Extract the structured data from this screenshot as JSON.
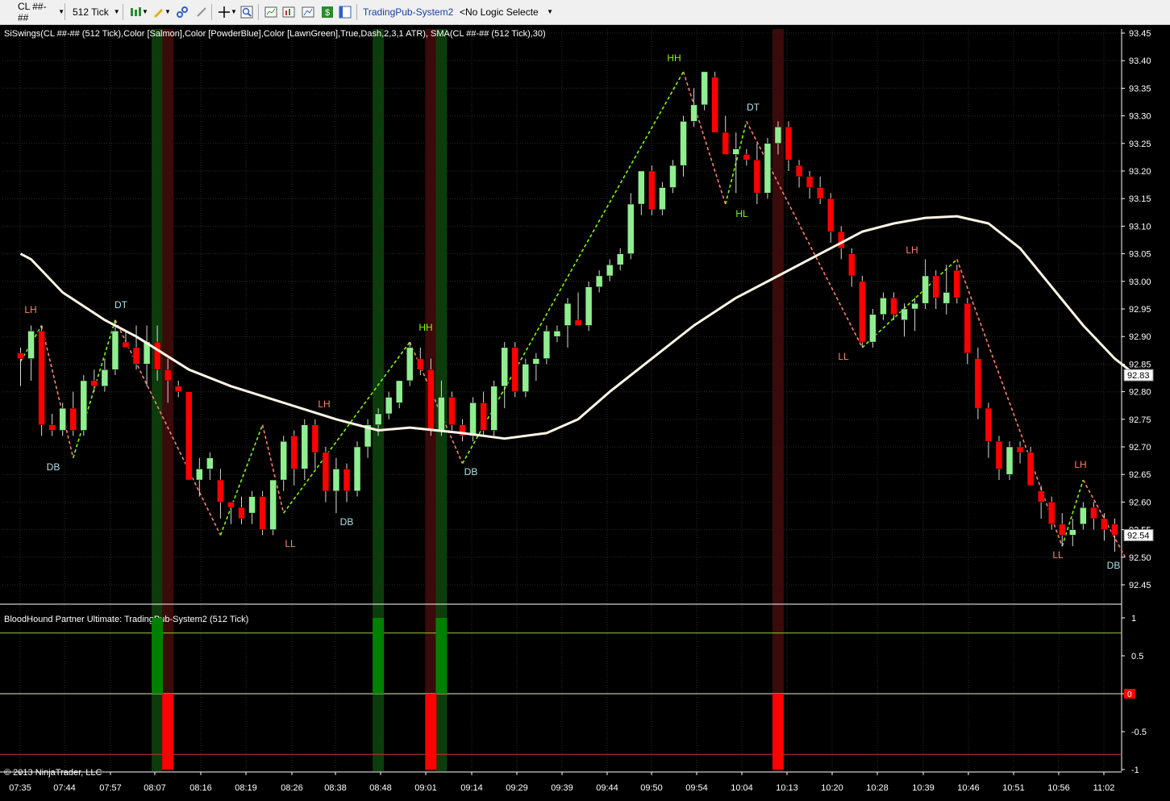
{
  "toolbar": {
    "instrument": "CL ##-##",
    "interval": "512 Tick",
    "strategy_label": "TradingPub-System2",
    "logic_select": "<No Logic Selecte",
    "icons": [
      "bar-style-icon",
      "draw-pencil-icon",
      "link-icon",
      "unlink-icon",
      "crosshair-icon",
      "zoom-icon",
      "data-box-icon",
      "chart-props-icon",
      "dollar-icon",
      "window-icon"
    ]
  },
  "price_panel": {
    "title": "SiSwings(CL ##-## (512 Tick),Color [Salmon],Color [PowderBlue],Color [LawnGreen],True,Dash,2,3,1 ATR), SMA(CL ##-## (512 Tick),30)",
    "y_ticks": [
      "93.45",
      "93.40",
      "93.35",
      "93.30",
      "93.25",
      "93.20",
      "93.15",
      "93.10",
      "93.05",
      "93.00",
      "92.95",
      "92.90",
      "92.85",
      "92.80",
      "92.75",
      "92.70",
      "92.65",
      "92.60",
      "92.55",
      "92.50",
      "92.45"
    ],
    "current_price": "92.83",
    "last_price": "92.54"
  },
  "swing_labels": [
    {
      "t": "LH",
      "c": "#fa8072"
    },
    {
      "t": "DT",
      "c": "#b0e0e6"
    },
    {
      "t": "DB",
      "c": "#b0e0e6"
    },
    {
      "t": "LH",
      "c": "#fa8072"
    },
    {
      "t": "LL",
      "c": "#fa8072"
    },
    {
      "t": "DB",
      "c": "#b0e0e6"
    },
    {
      "t": "HH",
      "c": "#7cfc00"
    },
    {
      "t": "DB",
      "c": "#b0e0e6"
    },
    {
      "t": "HH",
      "c": "#7cfc00"
    },
    {
      "t": "DT",
      "c": "#b0e0e6"
    },
    {
      "t": "HL",
      "c": "#7cfc00"
    },
    {
      "t": "LH",
      "c": "#fa8072"
    },
    {
      "t": "LL",
      "c": "#fa8072"
    },
    {
      "t": "LH",
      "c": "#fa8072"
    },
    {
      "t": "LL",
      "c": "#fa8072"
    },
    {
      "t": "DB",
      "c": "#b0e0e6"
    }
  ],
  "indicator_panel": {
    "title": "BloodHound Partner Ultimate: TradingPub-System2 (512 Tick)",
    "y_ticks": [
      "1",
      "0.5",
      "0",
      "-0.5",
      "-1"
    ],
    "copyright": "© 2013 NinjaTrader, LLC"
  },
  "x_ticks": [
    "07:35",
    "07:44",
    "07:57",
    "08:07",
    "08:16",
    "08:19",
    "08:26",
    "08:38",
    "08:48",
    "09:01",
    "09:14",
    "09:29",
    "09:39",
    "09:44",
    "09:50",
    "09:54",
    "10:04",
    "10:13",
    "10:20",
    "10:28",
    "10:39",
    "10:46",
    "10:51",
    "10:56",
    "11:02"
  ],
  "colors": {
    "up": "#90ee90",
    "down": "#ff0000",
    "sma": "#fff5e6",
    "signal_up": "#008000",
    "signal_down": "#ff0000"
  },
  "chart_data": {
    "type": "candlestick",
    "title": "SiSwings(CL ##-## (512 Tick),Color [Salmon],Color [PowderBlue],Color [LawnGreen],True,Dash,2,3,1 ATR), SMA(CL ##-## (512 Tick),30)",
    "ylim": [
      92.42,
      93.47
    ],
    "candles": [
      [
        92.87,
        92.88,
        92.81,
        92.86
      ],
      [
        92.86,
        92.92,
        92.82,
        92.91
      ],
      [
        92.91,
        92.92,
        92.72,
        92.74
      ],
      [
        92.74,
        92.76,
        92.72,
        92.73
      ],
      [
        92.73,
        92.78,
        92.72,
        92.77
      ],
      [
        92.77,
        92.8,
        92.72,
        92.73
      ],
      [
        92.73,
        92.83,
        92.72,
        92.82
      ],
      [
        92.82,
        92.84,
        92.8,
        92.81
      ],
      [
        92.81,
        92.86,
        92.8,
        92.84
      ],
      [
        92.84,
        92.93,
        92.83,
        92.91
      ],
      [
        92.89,
        92.91,
        92.88,
        92.88
      ],
      [
        92.88,
        92.92,
        92.84,
        92.85
      ],
      [
        92.85,
        92.92,
        92.81,
        92.89
      ],
      [
        92.89,
        92.92,
        92.82,
        92.84
      ],
      [
        92.84,
        92.86,
        92.78,
        92.82
      ],
      [
        92.81,
        92.82,
        92.79,
        92.8
      ],
      [
        92.8,
        92.8,
        92.66,
        92.64
      ],
      [
        92.64,
        92.68,
        92.61,
        92.66
      ],
      [
        92.66,
        92.69,
        92.64,
        92.68
      ],
      [
        92.64,
        92.66,
        92.57,
        92.6
      ],
      [
        92.6,
        92.6,
        92.56,
        92.59
      ],
      [
        92.59,
        92.61,
        92.56,
        92.57
      ],
      [
        92.58,
        92.62,
        92.56,
        92.61
      ],
      [
        92.61,
        92.62,
        92.54,
        92.55
      ],
      [
        92.55,
        92.64,
        92.54,
        92.64
      ],
      [
        92.64,
        92.72,
        92.62,
        92.71
      ],
      [
        92.72,
        92.73,
        92.63,
        92.66
      ],
      [
        92.66,
        92.75,
        92.64,
        92.74
      ],
      [
        92.74,
        92.75,
        92.66,
        92.69
      ],
      [
        92.69,
        92.7,
        92.6,
        92.62
      ],
      [
        92.62,
        92.68,
        92.58,
        92.66
      ],
      [
        92.66,
        92.67,
        92.6,
        92.62
      ],
      [
        92.62,
        92.71,
        92.61,
        92.7
      ],
      [
        92.7,
        92.75,
        92.68,
        92.74
      ],
      [
        92.74,
        92.77,
        92.72,
        92.76
      ],
      [
        92.76,
        92.8,
        92.75,
        92.79
      ],
      [
        92.78,
        92.82,
        92.77,
        92.82
      ],
      [
        92.82,
        92.89,
        92.81,
        92.88
      ],
      [
        92.86,
        92.88,
        92.83,
        92.84
      ],
      [
        92.84,
        92.86,
        92.72,
        92.73
      ],
      [
        92.73,
        92.82,
        92.72,
        92.79
      ],
      [
        92.79,
        92.8,
        92.73,
        92.74
      ],
      [
        92.74,
        92.75,
        92.71,
        92.72
      ],
      [
        92.72,
        92.79,
        92.71,
        92.78
      ],
      [
        92.78,
        92.8,
        92.72,
        92.73
      ],
      [
        92.73,
        92.82,
        92.72,
        92.81
      ],
      [
        92.81,
        92.89,
        92.77,
        92.88
      ],
      [
        92.88,
        92.89,
        92.79,
        92.8
      ],
      [
        92.8,
        92.86,
        92.79,
        92.85
      ],
      [
        92.85,
        92.87,
        92.82,
        92.86
      ],
      [
        92.86,
        92.92,
        92.85,
        92.91
      ],
      [
        92.9,
        92.92,
        92.89,
        92.91
      ],
      [
        92.92,
        92.97,
        92.88,
        92.96
      ],
      [
        92.93,
        92.98,
        92.92,
        92.92
      ],
      [
        92.92,
        93.0,
        92.91,
        92.99
      ],
      [
        92.99,
        93.02,
        92.98,
        93.01
      ],
      [
        93.01,
        93.04,
        93.0,
        93.03
      ],
      [
        93.03,
        93.06,
        93.02,
        93.05
      ],
      [
        93.05,
        93.16,
        93.04,
        93.14
      ],
      [
        93.14,
        93.2,
        93.12,
        93.2
      ],
      [
        93.2,
        93.21,
        93.12,
        93.13
      ],
      [
        93.13,
        93.18,
        93.12,
        93.17
      ],
      [
        93.17,
        93.22,
        93.16,
        93.21
      ],
      [
        93.21,
        93.3,
        93.19,
        93.29
      ],
      [
        93.29,
        93.35,
        93.28,
        93.32
      ],
      [
        93.32,
        93.38,
        93.31,
        93.38
      ],
      [
        93.37,
        93.38,
        93.27,
        93.27
      ],
      [
        93.27,
        93.3,
        93.23,
        93.23
      ],
      [
        93.23,
        93.27,
        93.16,
        93.24
      ],
      [
        93.23,
        93.24,
        93.21,
        93.22
      ],
      [
        93.22,
        93.25,
        93.14,
        93.16
      ],
      [
        93.16,
        93.26,
        93.15,
        93.25
      ],
      [
        93.25,
        93.29,
        93.23,
        93.28
      ],
      [
        93.28,
        93.29,
        93.2,
        93.22
      ],
      [
        93.21,
        93.22,
        93.17,
        93.19
      ],
      [
        93.19,
        93.2,
        93.15,
        93.17
      ],
      [
        93.17,
        93.19,
        93.14,
        93.15
      ],
      [
        93.15,
        93.16,
        93.07,
        93.09
      ],
      [
        93.09,
        93.1,
        93.04,
        93.06
      ],
      [
        93.05,
        93.06,
        92.99,
        93.01
      ],
      [
        93.0,
        93.01,
        92.88,
        92.89
      ],
      [
        92.89,
        92.95,
        92.88,
        92.94
      ],
      [
        92.94,
        92.98,
        92.93,
        92.97
      ],
      [
        92.97,
        92.98,
        92.93,
        92.94
      ],
      [
        92.93,
        92.96,
        92.9,
        92.95
      ],
      [
        92.95,
        92.97,
        92.91,
        92.96
      ],
      [
        92.96,
        93.04,
        92.95,
        93.01
      ],
      [
        93.01,
        93.02,
        92.95,
        92.97
      ],
      [
        92.96,
        93.03,
        92.94,
        92.98
      ],
      [
        93.02,
        93.03,
        92.96,
        92.97
      ],
      [
        92.96,
        92.97,
        92.85,
        92.87
      ],
      [
        92.86,
        92.88,
        92.75,
        92.77
      ],
      [
        92.77,
        92.78,
        92.68,
        92.71
      ],
      [
        92.71,
        92.72,
        92.64,
        92.66
      ],
      [
        92.65,
        92.71,
        92.64,
        92.7
      ],
      [
        92.7,
        92.71,
        92.67,
        92.69
      ],
      [
        92.69,
        92.7,
        92.63,
        92.63
      ],
      [
        92.62,
        92.63,
        92.57,
        92.6
      ],
      [
        92.6,
        92.61,
        92.55,
        92.56
      ],
      [
        92.56,
        92.58,
        92.52,
        92.54
      ],
      [
        92.54,
        92.57,
        92.52,
        92.55
      ],
      [
        92.56,
        92.6,
        92.55,
        92.59
      ],
      [
        92.59,
        92.6,
        92.55,
        92.57
      ],
      [
        92.57,
        92.58,
        92.53,
        92.55
      ],
      [
        92.56,
        92.57,
        92.51,
        92.54
      ]
    ],
    "sma": [
      [
        0,
        93.05
      ],
      [
        1,
        93.04
      ],
      [
        4,
        92.98
      ],
      [
        8,
        92.93
      ],
      [
        11,
        92.9
      ],
      [
        16,
        92.84
      ],
      [
        20,
        92.81
      ],
      [
        25,
        92.78
      ],
      [
        30,
        92.75
      ],
      [
        34,
        92.73
      ],
      [
        37,
        92.735
      ],
      [
        42,
        92.725
      ],
      [
        46,
        92.715
      ],
      [
        50,
        92.725
      ],
      [
        53,
        92.75
      ],
      [
        56,
        92.8
      ],
      [
        60,
        92.86
      ],
      [
        64,
        92.92
      ],
      [
        68,
        92.97
      ],
      [
        72,
        93.01
      ],
      [
        75,
        93.04
      ],
      [
        78,
        93.07
      ],
      [
        80,
        93.09
      ],
      [
        83,
        93.105
      ],
      [
        86,
        93.115
      ],
      [
        89,
        93.118
      ],
      [
        92,
        93.105
      ],
      [
        95,
        93.06
      ],
      [
        98,
        92.99
      ],
      [
        101,
        92.92
      ],
      [
        104,
        92.86
      ],
      [
        106,
        92.83
      ]
    ],
    "signals": [
      {
        "bar": 13,
        "value": 1
      },
      {
        "bar": 14,
        "value": -1
      },
      {
        "bar": 34,
        "value": 1
      },
      {
        "bar": 39,
        "value": -1
      },
      {
        "bar": 40,
        "value": 1
      },
      {
        "bar": 72,
        "value": -1
      }
    ]
  }
}
